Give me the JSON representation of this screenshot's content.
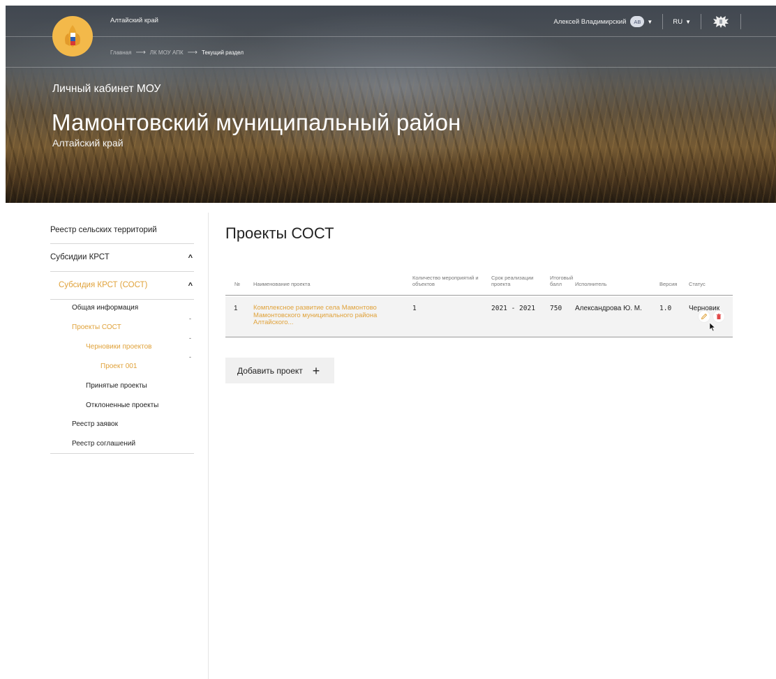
{
  "header": {
    "region_label": "Алтайский край",
    "breadcrumb": [
      {
        "label": "Главная"
      },
      {
        "label": "ЛК МОУ АПК"
      },
      {
        "label": "Текущий раздел"
      }
    ],
    "user_name": "Алексей Владимирский",
    "user_initials": "АВ",
    "language": "RU",
    "cabinet_title": "Личный кабинет МОУ",
    "district_title": "Мамонтовский муниципальный район",
    "district_subtitle": "Алтайский край",
    "icons": {
      "logo": "wheat-logo-icon",
      "user_menu": "caret-down-icon",
      "emblem": "coat-of-arms-icon"
    },
    "colors": {
      "logo_bg": "#f3b94a",
      "accent": "#e0a23a"
    }
  },
  "sidebar": {
    "items": [
      {
        "label": "Реестр сельских территорий"
      },
      {
        "label": "Субсидии КРСТ",
        "expanded": true
      },
      {
        "label": "Субсидия КРСТ (СОСТ)",
        "expanded": true,
        "active": true
      }
    ],
    "sub_items": [
      {
        "label": "Общая информация"
      },
      {
        "label": "Проекты СОСТ",
        "active": true
      },
      {
        "label": "Черновики проектов",
        "active": true
      },
      {
        "label": "Проект 001",
        "active": true
      },
      {
        "label": "Принятые проекты"
      },
      {
        "label": "Отклоненные проекты"
      },
      {
        "label": "Реестр заявок"
      },
      {
        "label": "Реестр соглашений"
      }
    ],
    "collapse_marker": "-"
  },
  "main": {
    "title": "Проекты СОСТ",
    "columns": {
      "num": "№",
      "name": "Наименование проекта",
      "count": "Количество мероприятий и объектов",
      "period": "Срок реализации проекта",
      "score": "Итоговый балл",
      "executor": "Исполнитель",
      "version": "Версия",
      "status": "Статус"
    },
    "rows": [
      {
        "num": "1",
        "name": "Комплексное развитие села Мамонтово Мамонтовского муниципального района Алтайского...",
        "count": "1",
        "period": "2021 - 2021",
        "score": "750",
        "executor": "Александрова Ю. М.",
        "version": "1.0",
        "status": "Черновик"
      }
    ],
    "row_actions": {
      "edit": "pencil-icon",
      "delete": "trash-icon"
    },
    "add_button_label": "Добавить проект",
    "add_button_icon": "+",
    "colors": {
      "delete": "#e04848",
      "edit": "#e0a23a"
    }
  }
}
